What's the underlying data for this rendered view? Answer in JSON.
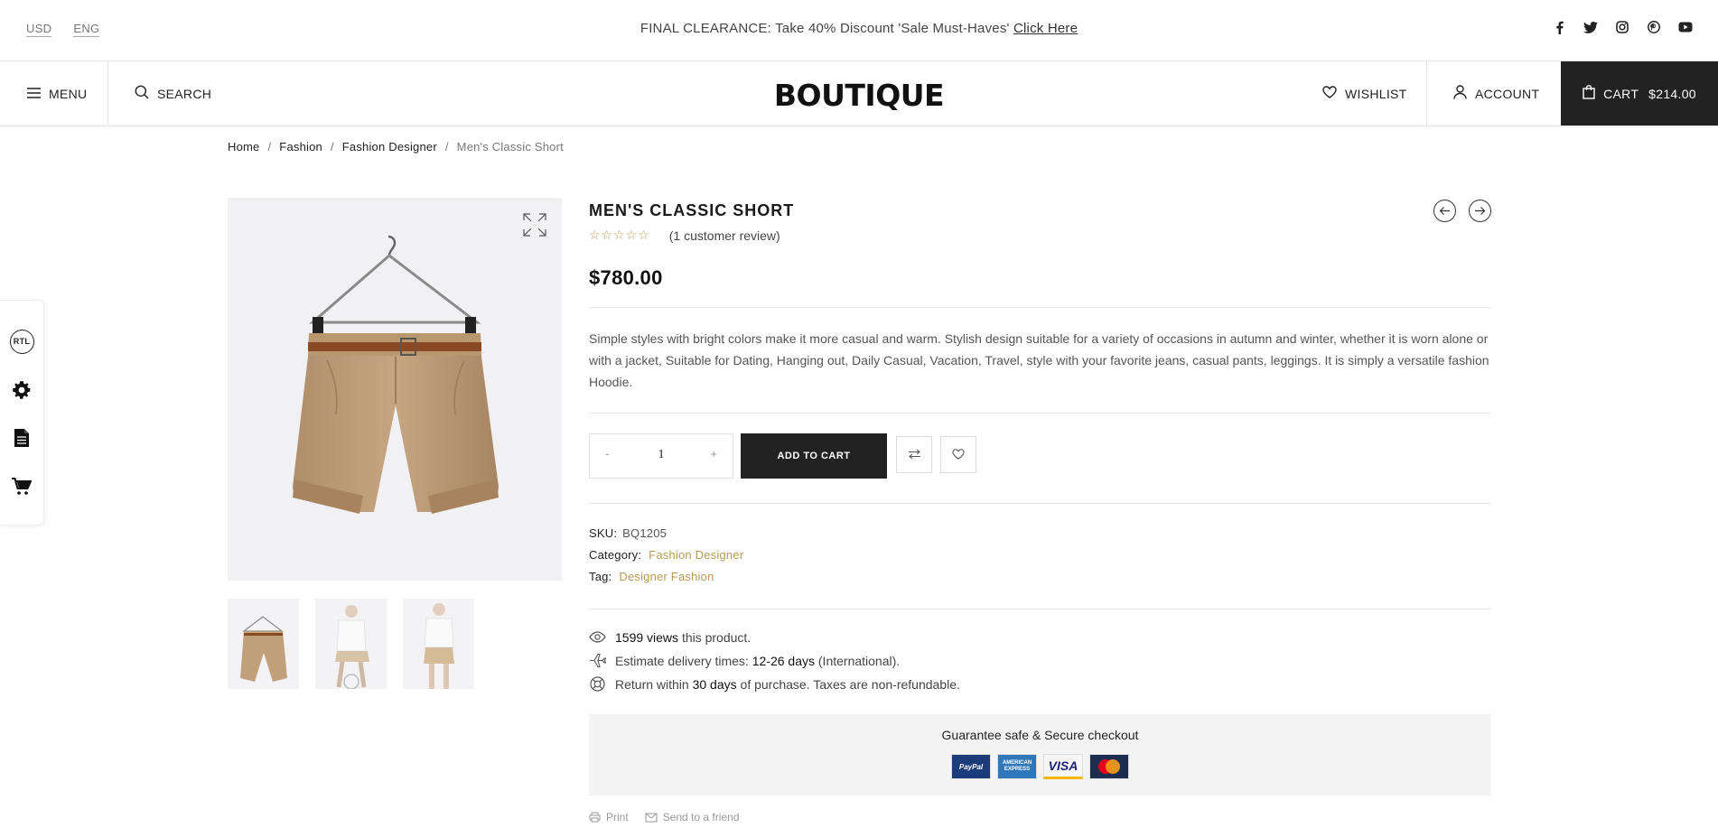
{
  "topbar": {
    "currency": "USD",
    "language": "ENG",
    "promo_text": "FINAL CLEARANCE: Take 40% Discount 'Sale Must-Haves'",
    "promo_link": "Click Here",
    "social_icons": [
      "facebook-icon",
      "twitter-icon",
      "instagram-icon",
      "pinterest-icon",
      "youtube-icon"
    ]
  },
  "header": {
    "menu_label": "MENU",
    "search_label": "SEARCH",
    "logo": "BOUTIQUE",
    "wishlist_label": "WISHLIST",
    "account_label": "ACCOUNT",
    "cart_label": "CART",
    "cart_amount": "$214.00"
  },
  "side_widget": {
    "rtl_label": "RTL",
    "icons": [
      "rtl-icon",
      "gear-icon",
      "document-icon",
      "cart-icon"
    ]
  },
  "breadcrumb": {
    "items": [
      "Home",
      "Fashion",
      "Fashion Designer"
    ],
    "separator": "/",
    "current": "Men's Classic Short"
  },
  "product": {
    "title": "MEN'S CLASSIC SHORT",
    "stars": "☆☆☆☆☆",
    "rating_value": 0,
    "review_text": "(1 customer review)",
    "price": "$780.00",
    "description": "Simple styles with bright colors make it more casual and warm. Stylish design suitable for a variety of occasions in autumn and winter, whether it is worn alone or with a jacket, Suitable for Dating, Hanging out, Daily Casual, Vacation, Travel, style with your favorite jeans, casual pants, leggings. It is simply a versatile fashion Hoodie.",
    "quantity": "1",
    "qty_minus": "-",
    "qty_plus": "+",
    "add_to_cart": "ADD TO CART",
    "sku_label": "SKU:",
    "sku": "BQ1205",
    "category_label": "Category:",
    "category": "Fashion Designer",
    "tag_label": "Tag:",
    "tag": "Designer Fashion",
    "views_count": "1599 views",
    "views_suffix": "this product.",
    "delivery_prefix": "Estimate delivery times:",
    "delivery_days": "12-26 days",
    "delivery_suffix": "(International).",
    "return_prefix": "Return within",
    "return_days": "30 days",
    "return_suffix": "of purchase. Taxes are non-refundable.",
    "checkout_title": "Guarantee safe & Secure checkout",
    "payment_cards": [
      "PayPal",
      "AMERICAN EXPRESS",
      "VISA",
      "MasterCard"
    ],
    "print_label": "Print",
    "send_label": "Send to a friend"
  },
  "colors": {
    "accent_gold": "#b89a55",
    "dark": "#222222",
    "border": "#e6e6e6"
  }
}
